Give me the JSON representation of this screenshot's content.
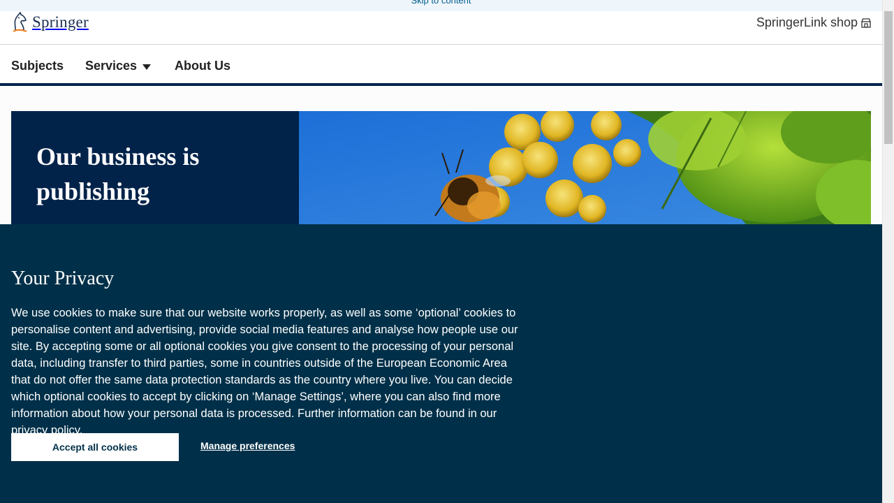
{
  "skip_link": "Skip to content",
  "brand": {
    "name": "Springer"
  },
  "header": {
    "shop_label": "SpringerLink shop"
  },
  "nav": {
    "subjects": "Subjects",
    "services": "Services",
    "about": "About Us"
  },
  "hero": {
    "title": "Our business is publishing"
  },
  "privacy": {
    "title": "Your Privacy",
    "body": "We use cookies to make sure that our website works properly, as well as some ‘optional’ cookies to personalise content and advertising, provide social media features and analyse how people use our site. By accepting some or all optional cookies you give consent to the processing of your personal data, including transfer to third parties, some in countries outside of the European Economic Area that do not offer the same data protection standards as the country where you live. You can decide which optional cookies to accept by clicking on ‘Manage Settings’, where you can also find more information about how your personal data is processed. Further information can be found in our",
    "policy_link": "privacy policy",
    "body_end": ".",
    "accept_label": "Accept all cookies",
    "manage_label": "Manage preferences"
  },
  "colors": {
    "navy": "#01234a",
    "privacy_bg": "#003049",
    "link_blue": "#025e8d",
    "logo_orange": "#f58220"
  },
  "icons": {
    "logo": "springer-knight-icon",
    "shop": "shop-icon",
    "caret": "caret-down-icon"
  }
}
